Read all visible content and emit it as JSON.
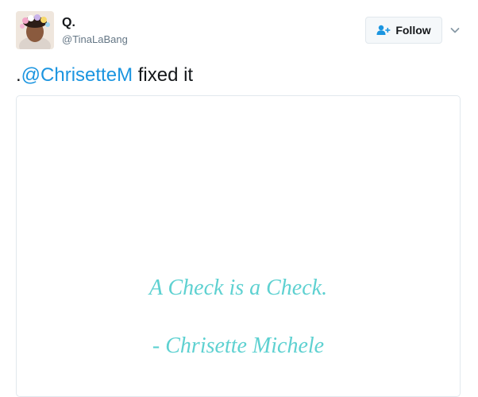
{
  "author": {
    "display_name": "Q.",
    "handle": "@TinaLaBang"
  },
  "follow_button": {
    "label": "Follow",
    "icon": "add-user-icon"
  },
  "menu_icon": "chevron-down-icon",
  "tweet": {
    "prefix": ".",
    "mention": "@ChrisetteM",
    "suffix": " fixed it"
  },
  "media": {
    "quote_line_1": "A Check is a Check.",
    "quote_line_2": "- Chrisette Michele"
  },
  "colors": {
    "link": "#1b95e0",
    "quote": "#5ed1d1",
    "border": "#e1e8ed",
    "muted": "#657786"
  }
}
